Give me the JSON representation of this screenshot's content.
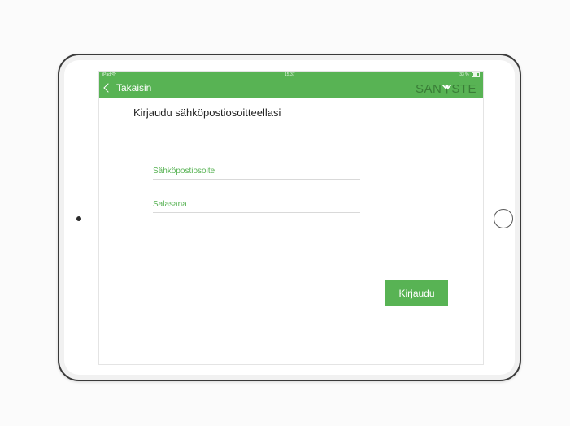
{
  "status_bar": {
    "carrier": "iPad",
    "time": "15.37",
    "battery": "33 %"
  },
  "nav": {
    "back_label": "Takaisin",
    "logo_left": "SAN",
    "logo_right": "STE"
  },
  "login": {
    "title": "Kirjaudu sähköpostiosoitteellasi",
    "email_placeholder": "Sähköpostiosoite",
    "password_placeholder": "Salasana",
    "submit_label": "Kirjaudu"
  },
  "colors": {
    "brand_green": "#58b354",
    "logo_green": "#3a7d37"
  },
  "icons": [
    "wifi-icon",
    "chevron-left-icon",
    "battery-icon",
    "logo-figure-icon",
    "home-button",
    "camera"
  ]
}
